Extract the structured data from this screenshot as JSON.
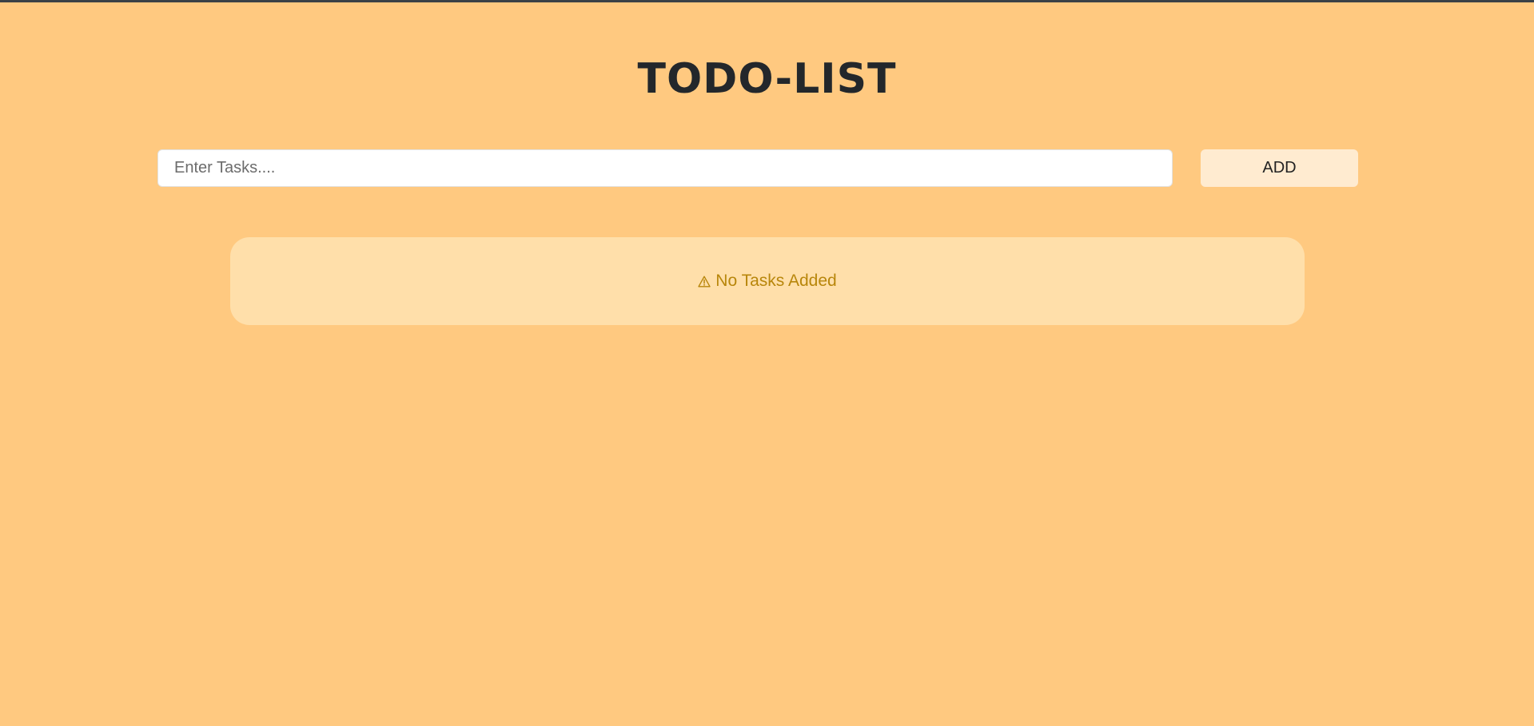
{
  "header": {
    "title": "TODO-LIST"
  },
  "task_form": {
    "input_placeholder": "Enter Tasks....",
    "input_value": "",
    "add_label": "ADD"
  },
  "task_list": {
    "empty_message": "No Tasks Added",
    "empty_icon": "warning-icon"
  },
  "colors": {
    "background": "#ffc980",
    "panel": "#ffdfaa",
    "button": "#ffebd0",
    "warning_text": "#b8860b",
    "title_text": "#23272b"
  }
}
